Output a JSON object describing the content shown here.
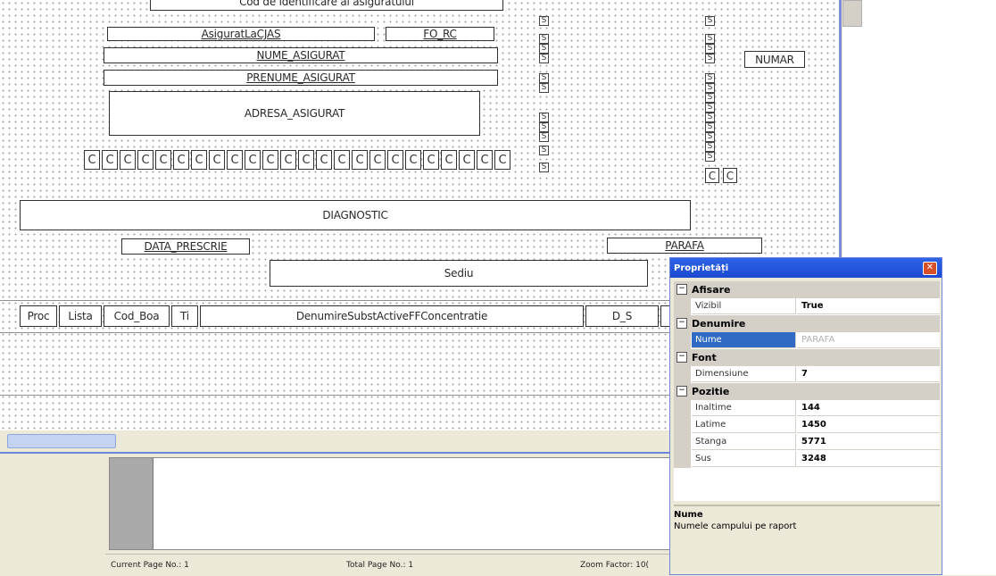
{
  "design": {
    "top_cut_label": "Cod de identificare al asiguratului",
    "fields": {
      "asigurat_cjas": "AsiguratLaCJAS",
      "fo_rc": "FO_RC",
      "nume_asigurat": "NUME_ASIGURAT",
      "prenume_asigurat": "PRENUME_ASIGURAT",
      "adresa_asigurat": "ADRESA_ASIGURAT",
      "numar": "NUMAR",
      "diagnostic": "DIAGNOSTIC",
      "data_prescrie": "DATA_PRESCRIE",
      "parafa": "PARAFA",
      "sediu": "Sediu"
    },
    "c_letter": "C",
    "s_letter": "S",
    "table_headers": [
      "Proc",
      "Lista",
      "Cod_Boa",
      "Ti",
      "DenumireSubstActiveFFConcentratie",
      "D_S"
    ]
  },
  "status": {
    "current_page": "Current Page No.: 1",
    "total_page": "Total Page No.: 1",
    "zoom": "Zoom Factor: 10("
  },
  "properties": {
    "title": "Proprietăți",
    "close_glyph": "✕",
    "categories": [
      {
        "label": "Afisare",
        "rows": [
          {
            "name": "Vizibil",
            "value": "True"
          }
        ]
      },
      {
        "label": "Denumire",
        "rows": [
          {
            "name": "Nume",
            "value": "PARAFA"
          }
        ]
      },
      {
        "label": "Font",
        "rows": [
          {
            "name": "Dimensiune",
            "value": "7"
          }
        ]
      },
      {
        "label": "Pozitie",
        "rows": [
          {
            "name": "Inaltime",
            "value": "144"
          },
          {
            "name": "Latime",
            "value": "1450"
          },
          {
            "name": "Stanga",
            "value": "5771"
          },
          {
            "name": "Sus",
            "value": "3248"
          }
        ]
      }
    ],
    "collapse_glyph": "⊟",
    "description_title": "Nume",
    "description_text": "Numele campului pe raport"
  }
}
